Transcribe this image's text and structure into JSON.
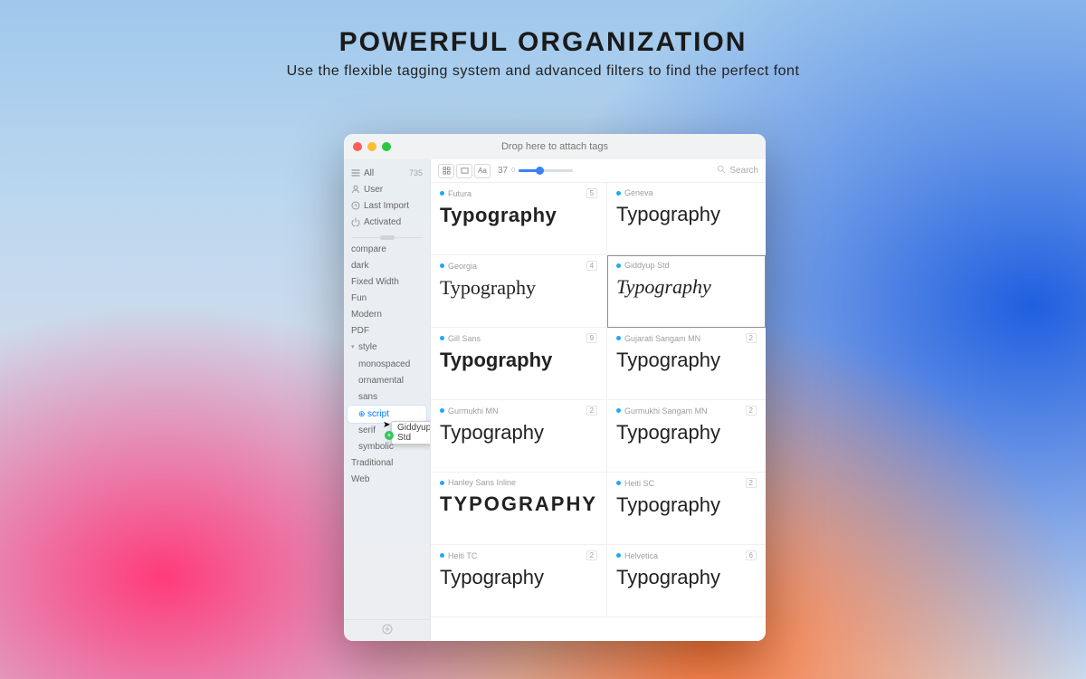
{
  "hero": {
    "title": "POWERFUL ORGANIZATION",
    "subtitle": "Use the flexible tagging system and advanced filters to find the perfect font"
  },
  "window": {
    "title": "Drop here to attach tags"
  },
  "sidebar": {
    "all": {
      "label": "All",
      "count": "735"
    },
    "user": "User",
    "last_import": "Last Import",
    "activated": "Activated",
    "tags": [
      {
        "label": "compare"
      },
      {
        "label": "dark"
      },
      {
        "label": "Fixed Width"
      },
      {
        "label": "Fun"
      },
      {
        "label": "Modern"
      },
      {
        "label": "PDF"
      },
      {
        "label": "style",
        "group": true,
        "open": true
      },
      {
        "label": "monospaced",
        "child": true
      },
      {
        "label": "ornamental",
        "child": true
      },
      {
        "label": "sans",
        "child": true
      },
      {
        "label": "script",
        "child": true,
        "selected": true
      },
      {
        "label": "serif",
        "child": true
      },
      {
        "label": "symbolic",
        "child": true
      },
      {
        "label": "Traditional"
      },
      {
        "label": "Web"
      }
    ],
    "drag_label": "Giddyup Std"
  },
  "toolbar": {
    "view_glyph_a": "Aa",
    "size_value": "37",
    "size_min": "0",
    "size_fill_percent": 38,
    "search_placeholder": "Search"
  },
  "sample_text": "Typography",
  "fonts": [
    {
      "name": "Futura",
      "count": "5",
      "style": "font-family:Futura,'Century Gothic',sans-serif;font-weight:700;letter-spacing:.5px"
    },
    {
      "name": "Geneva",
      "count": "",
      "style": "font-family:Geneva,Verdana,sans-serif"
    },
    {
      "name": "Georgia",
      "count": "4",
      "style": "font-family:Georgia,serif"
    },
    {
      "name": "Giddyup Std",
      "count": "",
      "style": "font-family:'Brush Script MT','Segoe Script',cursive;font-style:italic",
      "selected": true
    },
    {
      "name": "Gill Sans",
      "count": "9",
      "style": "font-family:'Gill Sans','Gill Sans MT',sans-serif;font-weight:700"
    },
    {
      "name": "Gujarati Sangam MN",
      "count": "2",
      "style": "font-family:Arial,sans-serif"
    },
    {
      "name": "Gurmukhi MN",
      "count": "2",
      "style": "font-family:Arial,sans-serif"
    },
    {
      "name": "Gurmukhi Sangam MN",
      "count": "2",
      "style": "font-family:Arial,sans-serif"
    },
    {
      "name": "Hanley Sans Inline",
      "count": "",
      "style": "font-family:Impact,sans-serif;letter-spacing:2px;text-transform:uppercase;font-weight:700"
    },
    {
      "name": "Heiti SC",
      "count": "2",
      "style": "font-family:'Helvetica Neue',Arial,sans-serif"
    },
    {
      "name": "Heiti TC",
      "count": "2",
      "style": "font-family:'Helvetica Neue',Arial,sans-serif"
    },
    {
      "name": "Helvetica",
      "count": "6",
      "style": "font-family:Helvetica,Arial,sans-serif"
    }
  ]
}
